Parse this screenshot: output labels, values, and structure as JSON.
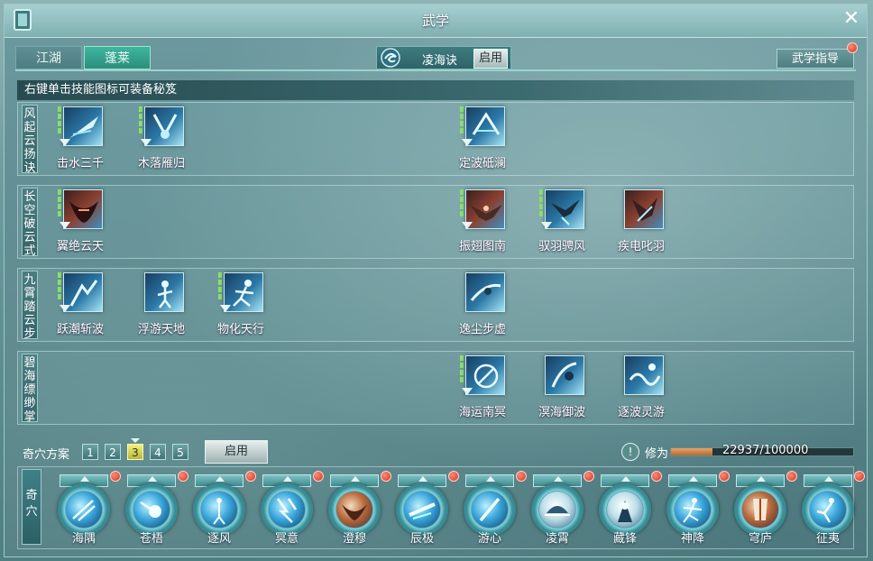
{
  "window": {
    "title": "武学"
  },
  "tabs": [
    {
      "label": "江湖"
    },
    {
      "label": "蓬莱",
      "active": true
    }
  ],
  "skillset": {
    "name": "凌海诀",
    "enable_label": "启用"
  },
  "guide": {
    "label": "武学指导"
  },
  "hint": "右键单击技能图标可装备秘笈",
  "rows": [
    {
      "label": "风起云扬诀",
      "skills": [
        "击水三千",
        "木落雁归",
        "定波砥澜"
      ]
    },
    {
      "label": "长空破云式",
      "skills": [
        "翼绝云天",
        "振翅图南",
        "驭羽骋风",
        "疾电叱羽"
      ]
    },
    {
      "label": "九霄踏云步",
      "skills": [
        "跃潮斩波",
        "浮游天地",
        "物化天行",
        "逸尘步虚"
      ]
    },
    {
      "label": "碧海缥缈掌",
      "skills": [
        "海运南冥",
        "溟海御波",
        "逐波灵游"
      ]
    }
  ],
  "plan": {
    "label": "奇穴方案",
    "options": [
      "1",
      "2",
      "3",
      "4",
      "5"
    ],
    "selected": "3",
    "enable_label": "启用"
  },
  "cultivation": {
    "info_glyph": "!",
    "label": "修为",
    "current": 22937,
    "max": 100000,
    "text": "22937/100000"
  },
  "qixue": {
    "label": "奇穴",
    "slots": [
      "海隅",
      "苍梧",
      "逐风",
      "冥意",
      "澄穆",
      "辰极",
      "游心",
      "凌霄",
      "藏锋",
      "神降",
      "穹庐",
      "征夷"
    ]
  },
  "colors": {
    "accent": "#3fb59d",
    "alert": "#d33322",
    "progress": "#e7a46a"
  }
}
